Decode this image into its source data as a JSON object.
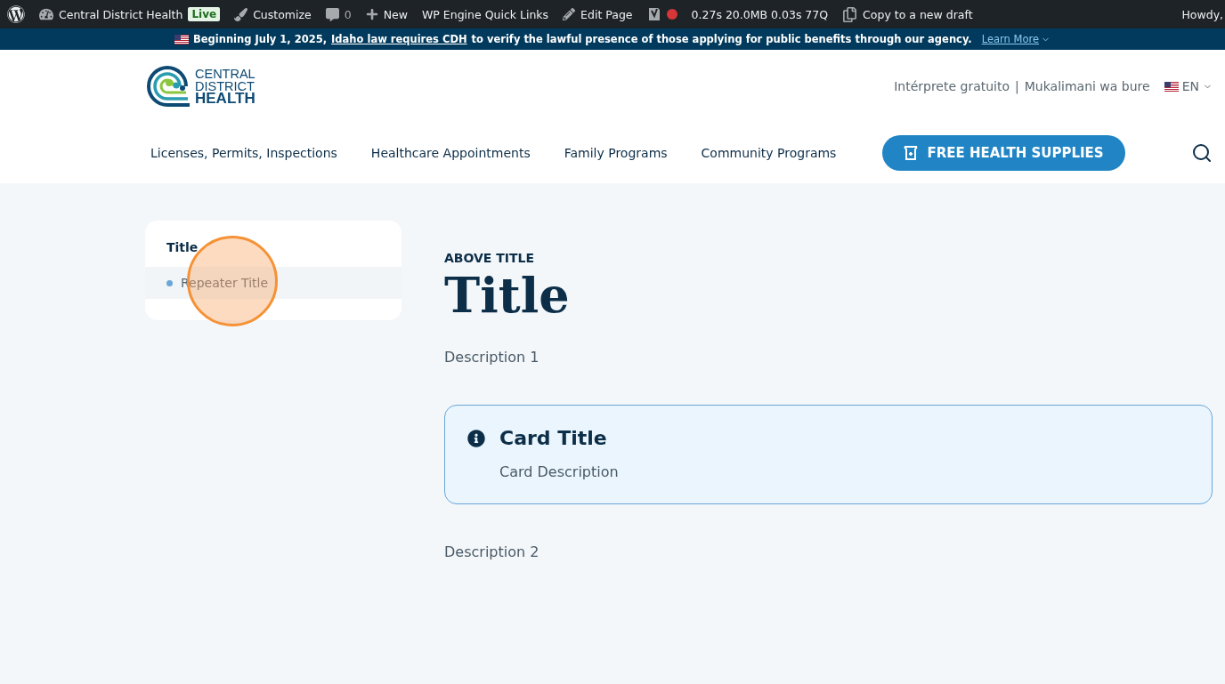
{
  "admin_bar": {
    "items": [
      {
        "kind": "logo"
      },
      {
        "kind": "site",
        "label": "Central District Health",
        "badge": "Live"
      },
      {
        "kind": "brush",
        "label": "Customize"
      },
      {
        "kind": "comments",
        "label": "0"
      },
      {
        "kind": "new",
        "label": "New"
      },
      {
        "kind": "text",
        "label": "WP Engine Quick Links"
      },
      {
        "kind": "edit",
        "label": "Edit Page"
      },
      {
        "kind": "yoast"
      },
      {
        "kind": "stats",
        "label": "0.27s  20.0MB  0.03s  77Q"
      },
      {
        "kind": "copy",
        "label": "Copy to a new draft"
      }
    ],
    "greeting": "Howdy,"
  },
  "notice": {
    "text": "Beginning July 1, 2025,",
    "link": "Idaho law requires CDH",
    "rest": "to verify the lawful presence of those applying for public benefits through our agency.",
    "learn_more": "Learn More"
  },
  "header": {
    "logo": [
      "CENTRAL",
      "DISTRICT",
      "HEALTH"
    ],
    "interpreter_links": [
      "Intérprete gratuito",
      "Mukalimani wa bure"
    ],
    "separator": "|",
    "language": "EN",
    "nav": [
      "Licenses, Permits, Inspections",
      "Healthcare Appointments",
      "Family Programs",
      "Community Programs"
    ],
    "cta": "FREE HEALTH SUPPLIES"
  },
  "sidebar": {
    "title": "Title",
    "items": [
      {
        "label": "Repeater Title",
        "selected": true
      }
    ]
  },
  "content": {
    "above_title": "ABOVE TITLE",
    "title": "Title",
    "description_1": "Description 1",
    "card": {
      "title": "Card Title",
      "description": "Card Description"
    },
    "description_2": "Description 2"
  }
}
